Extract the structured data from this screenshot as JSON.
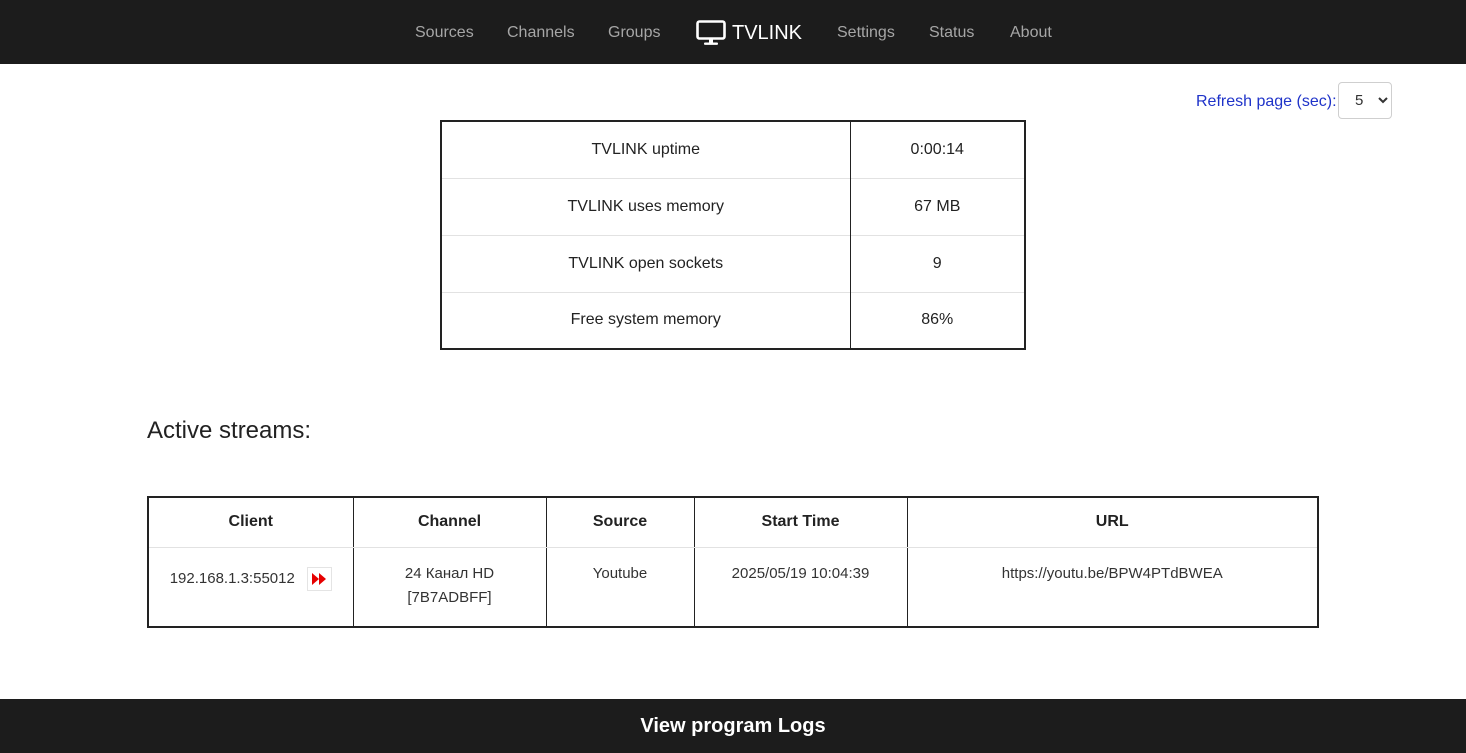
{
  "nav": {
    "items": [
      "Sources",
      "Channels",
      "Groups",
      "Settings",
      "Status",
      "About"
    ],
    "brand": "TVLINK",
    "brand_icon": "monitor-icon"
  },
  "refresh": {
    "label": "Refresh page (sec):",
    "value": "5"
  },
  "stats": [
    {
      "label": "TVLINK uptime",
      "value": "0:00:14"
    },
    {
      "label": "TVLINK uses memory",
      "value": "67 MB"
    },
    {
      "label": "TVLINK open sockets",
      "value": "9"
    },
    {
      "label": "Free system memory",
      "value": "86%"
    }
  ],
  "streams": {
    "title": "Active streams:",
    "columns": [
      "Client",
      "Channel",
      "Source",
      "Start Time",
      "URL"
    ],
    "rows": [
      {
        "client": "192.168.1.3:55012",
        "action_icon": "fast-forward-icon",
        "channel_name": "24 Канал HD",
        "channel_id": "[7B7ADBFF]",
        "source": "Youtube",
        "start_time": "2025/05/19 10:04:39",
        "url": "https://youtu.be/BPW4PTdBWEA"
      }
    ]
  },
  "footer": {
    "link": "View program Logs"
  },
  "colors": {
    "navbar_bg": "#1c1c1c",
    "nav_text": "#a6a6a6",
    "brand_text": "#ffffff",
    "refresh_label": "#1f33c9",
    "action_icon": "#e60000"
  }
}
